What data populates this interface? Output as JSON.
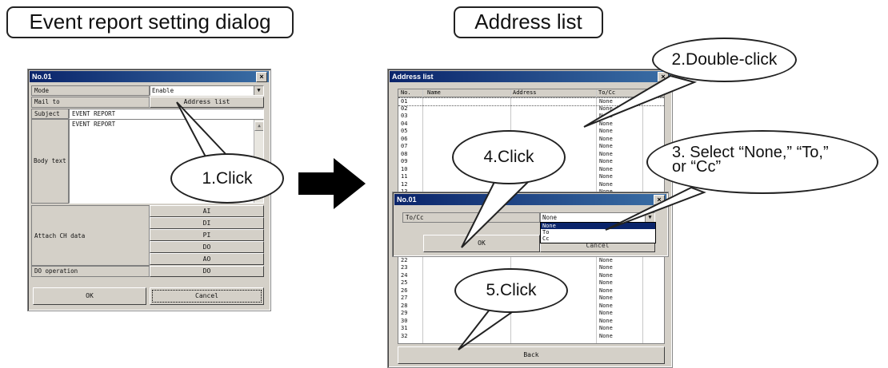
{
  "headings": {
    "left": "Event report setting dialog",
    "right": "Address list"
  },
  "dialog1": {
    "title": "No.01",
    "close": "×",
    "mode_label": "Mode",
    "mode_value": "Enable",
    "mail_to_label": "Mail to",
    "address_list_button": "Address list",
    "subject_label": "Subject",
    "subject_value": "EVENT REPORT",
    "body_label": "Body text",
    "body_value": "EVENT REPORT",
    "attach_label": "Attach CH data",
    "attach_buttons": [
      "AI",
      "DI",
      "PI",
      "DO",
      "AO"
    ],
    "do_operation_label": "DO operation",
    "do_operation_button": "DO",
    "ok": "OK",
    "cancel": "Cancel"
  },
  "address_list": {
    "title": "Address list",
    "close": "×",
    "columns": [
      "No.",
      "Name",
      "Address",
      "To/Cc"
    ],
    "rows": [
      "01",
      "02",
      "03",
      "04",
      "05",
      "06",
      "07",
      "08",
      "09",
      "10",
      "11",
      "12",
      "13",
      "14",
      "15",
      "16",
      "17",
      "18",
      "19",
      "20",
      "21",
      "22",
      "23",
      "24",
      "25",
      "26",
      "27",
      "28",
      "29",
      "30",
      "31",
      "32"
    ],
    "to_cc_value": "None",
    "back": "Back"
  },
  "dialog2": {
    "title": "No.01",
    "close": "×",
    "field_label": "To/Cc",
    "selected": "None",
    "options": [
      "None",
      "To",
      "Cc"
    ],
    "ok": "OK",
    "cancel": "Cancel"
  },
  "callouts": {
    "c1": "1.Click",
    "c2": "2.Double-click",
    "c3_line1": "3. Select “None,” “To,”",
    "c3_line2": "or “Cc”",
    "c4": "4.Click",
    "c5": "5.Click"
  },
  "colors": {
    "titlebar": "#0a246a",
    "dialog_face": "#d4d0c8",
    "selection": "#0a246a"
  }
}
